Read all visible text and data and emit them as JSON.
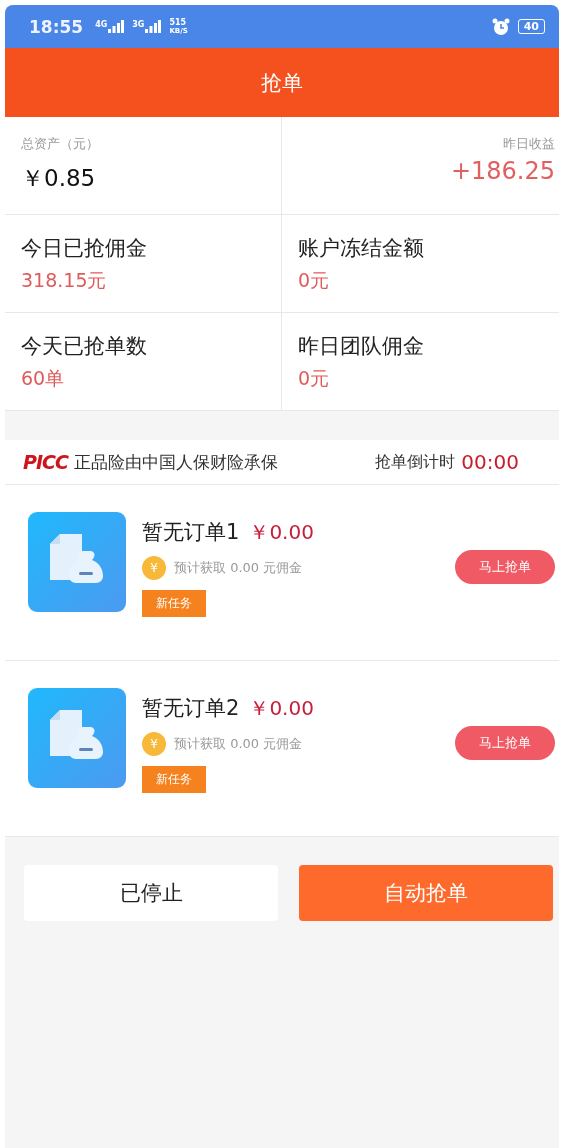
{
  "status_bar": {
    "time": "18:55",
    "networks": [
      {
        "label": "4G"
      },
      {
        "label": "3G"
      }
    ],
    "speed": "515",
    "speed_unit": "KB/S",
    "battery": "40"
  },
  "header": {
    "title": "抢单"
  },
  "summary": {
    "total_label": "总资产（元）",
    "total_value": "￥0.85",
    "yesterday_label": "昨日收益",
    "yesterday_value": "+186.25"
  },
  "stats": [
    {
      "label": "今日已抢佣金",
      "value": "318.15元"
    },
    {
      "label": "账户冻结金额",
      "value": "0元"
    },
    {
      "label": "今天已抢单数",
      "value": "60单"
    },
    {
      "label": "昨日团队佣金",
      "value": "0元"
    }
  ],
  "insurer": {
    "brand": "PICC",
    "tagline": "正品险由中国人保财险承保",
    "countdown_label": "抢单倒计时",
    "countdown_value": "00:00"
  },
  "orders": [
    {
      "title": "暂无订单1",
      "price": "￥0.00",
      "coin": "¥",
      "estimate": "预计获取 0.00 元佣金",
      "tag": "新任务",
      "action": "马上抢单"
    },
    {
      "title": "暂无订单2",
      "price": "￥0.00",
      "coin": "¥",
      "estimate": "预计获取 0.00 元佣金",
      "tag": "新任务",
      "action": "马上抢单"
    }
  ],
  "buttons": [
    {
      "label": "已停止",
      "kind": "secondary"
    },
    {
      "label": "自动抢单",
      "kind": "primary"
    }
  ]
}
